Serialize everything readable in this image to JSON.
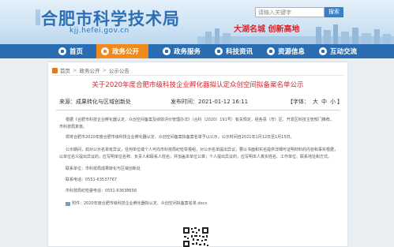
{
  "header": {
    "logo_text": "合肥市科学技术局",
    "logo_url": "kjj.hefei.gov.cn",
    "search_placeholder": "请输入关键字",
    "search_button": "搜索",
    "slogan": "大湖名城 创新高地"
  },
  "nav": {
    "items": [
      {
        "label": "首页",
        "active": false
      },
      {
        "label": "政务公开",
        "active": true
      },
      {
        "label": "政务服务",
        "active": false
      },
      {
        "label": "科技资讯",
        "active": false
      },
      {
        "label": "资源信息",
        "active": false
      },
      {
        "label": "互动交流",
        "active": false
      }
    ]
  },
  "breadcrumb": {
    "items": [
      "首页",
      "政务公开",
      "公示公告"
    ],
    "separator": ">"
  },
  "article": {
    "title": "关于2020年度合肥市级科技企业孵化器拟认定众创空间拟备案名单公示",
    "source": "来源：成果转化与区域创新处",
    "time": "发布时间：2021-01-12 16:11",
    "font_label": "【字体：",
    "font_sizes": [
      "大",
      "中",
      "小"
    ],
    "font_close": "】",
    "paragraphs": [
      "根据《合肥市科技企业孵化器认定、众创空间备案及绩效评价管理办法》（合科〔2020〕191号）有关规定，经各县（市）区、开发区科技主管部门推荐，",
      "市科技局复核。",
      "现将合肥市2020年度合肥市级科技企业孵化器认定、众创空间备案拟备案名单予以公示，公示时间自2021年1月12日至1月15日。",
      "公示期间，如对公示名单有异议，任何单位或个人可向市科技局纪检举报组，对公示名单提出异议，要以书面和实名提供详细可证明材料的内容和事实根据，",
      "以单位名义提出异议的，应写明单位名称、负责人和联系人姓名，并加盖本单位公章；个人提出异议的，应写明本人真实姓名、工作单位、联系地址和方式。",
      "联系单位：市科技局成果转化与区域创新处",
      "联系电话：0551-63537767",
      "市科技局纪检委电话：0551-63638658",
      "附件：2020年度合肥市级科技企业孵化器拟认定、众创空间拟备案名单.docx"
    ]
  },
  "colors": {
    "nav_bg": "#2a6db3",
    "nav_active": "#f08a1c",
    "title_red": "#d8232a",
    "logo_blue": "#2d6fb5"
  }
}
